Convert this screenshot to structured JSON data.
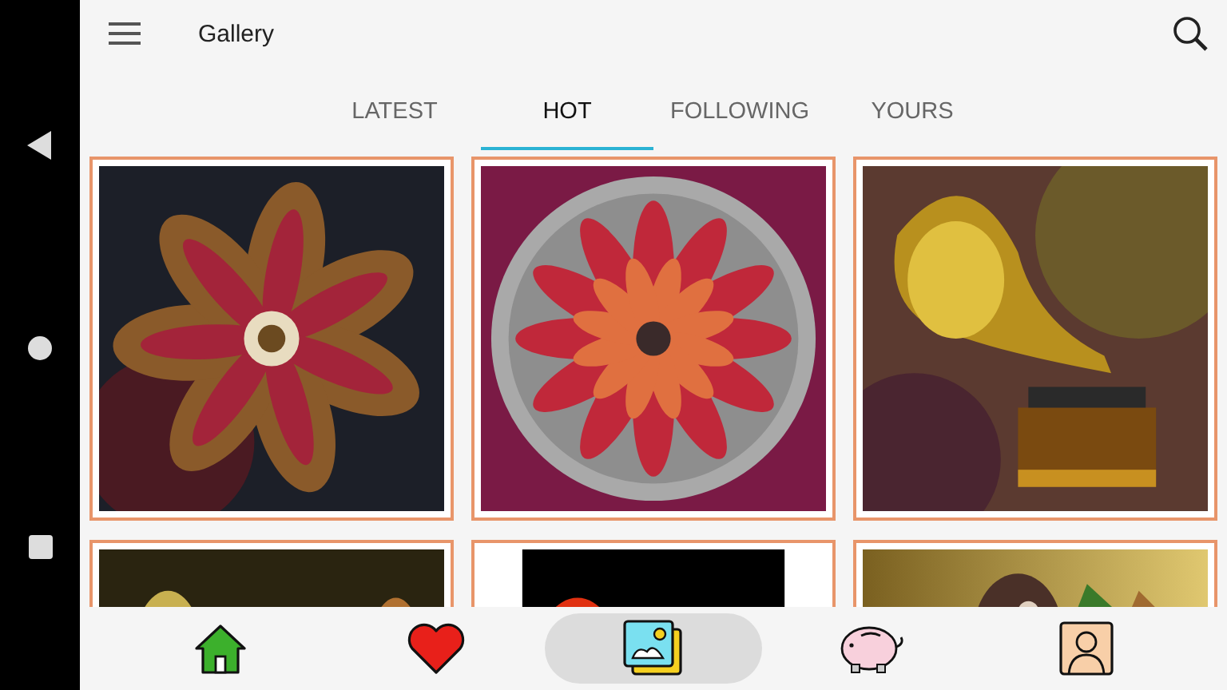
{
  "app_bar": {
    "title": "Gallery"
  },
  "tabs": [
    {
      "label": "LATEST",
      "selected": false
    },
    {
      "label": "HOT",
      "selected": true
    },
    {
      "label": "FOLLOWING",
      "selected": false
    },
    {
      "label": "YOURS",
      "selected": false
    }
  ],
  "bottom_nav": [
    {
      "selected": false
    },
    {
      "selected": false
    },
    {
      "selected": true
    },
    {
      "selected": false
    },
    {
      "selected": false
    }
  ]
}
